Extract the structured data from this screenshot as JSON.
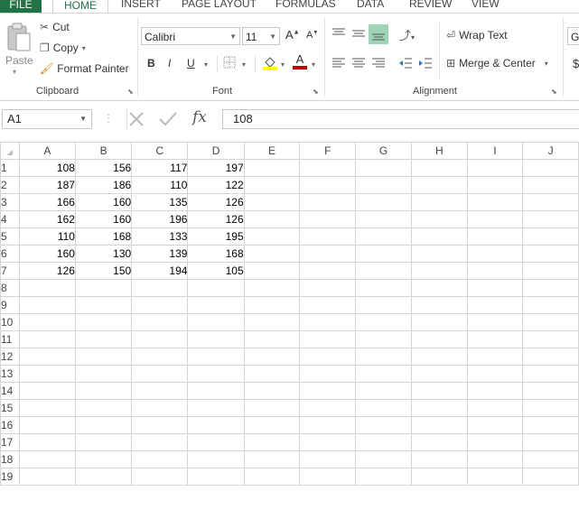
{
  "tabs": [
    "FILE",
    "HOME",
    "INSERT",
    "PAGE LAYOUT",
    "FORMULAS",
    "DATA",
    "REVIEW",
    "VIEW"
  ],
  "clipboard": {
    "paste": "Paste",
    "cut": "Cut",
    "copy": "Copy",
    "format_painter": "Format Painter",
    "label": "Clipboard"
  },
  "font": {
    "name": "Calibri",
    "size": "11",
    "bold": "B",
    "italic": "I",
    "underline": "U",
    "grow": "A",
    "shrink": "A",
    "font_color_glyph": "A",
    "label": "Font"
  },
  "alignment": {
    "wrap_text": "Wrap Text",
    "merge_center": "Merge & Center",
    "label": "Alignment"
  },
  "number_partial": {
    "format": "Ge",
    "currency": "$"
  },
  "formula_bar": {
    "name_box": "A1",
    "fx": "fx",
    "content": "108"
  },
  "columns": [
    "A",
    "B",
    "C",
    "D",
    "E",
    "F",
    "G",
    "H",
    "I",
    "J"
  ],
  "rows": [
    {
      "n": "1",
      "cells": [
        "108",
        "156",
        "117",
        "197"
      ]
    },
    {
      "n": "2",
      "cells": [
        "187",
        "186",
        "110",
        "122"
      ]
    },
    {
      "n": "3",
      "cells": [
        "166",
        "160",
        "135",
        "126"
      ]
    },
    {
      "n": "4",
      "cells": [
        "162",
        "160",
        "196",
        "126"
      ]
    },
    {
      "n": "5",
      "cells": [
        "110",
        "168",
        "133",
        "195"
      ]
    },
    {
      "n": "6",
      "cells": [
        "160",
        "130",
        "139",
        "168"
      ]
    },
    {
      "n": "7",
      "cells": [
        "126",
        "150",
        "194",
        "105"
      ]
    },
    {
      "n": "8",
      "cells": []
    },
    {
      "n": "9",
      "cells": []
    },
    {
      "n": "10",
      "cells": []
    },
    {
      "n": "11",
      "cells": []
    },
    {
      "n": "12",
      "cells": []
    },
    {
      "n": "13",
      "cells": []
    },
    {
      "n": "14",
      "cells": []
    },
    {
      "n": "15",
      "cells": []
    },
    {
      "n": "16",
      "cells": []
    },
    {
      "n": "17",
      "cells": []
    },
    {
      "n": "18",
      "cells": []
    },
    {
      "n": "19",
      "cells": []
    }
  ],
  "colors": {
    "accent": "#217346",
    "grid": "#d4d4d4",
    "font_color_bar": "#c00000",
    "highlight": "#ffff00",
    "active_align": "#9fd5b7"
  }
}
